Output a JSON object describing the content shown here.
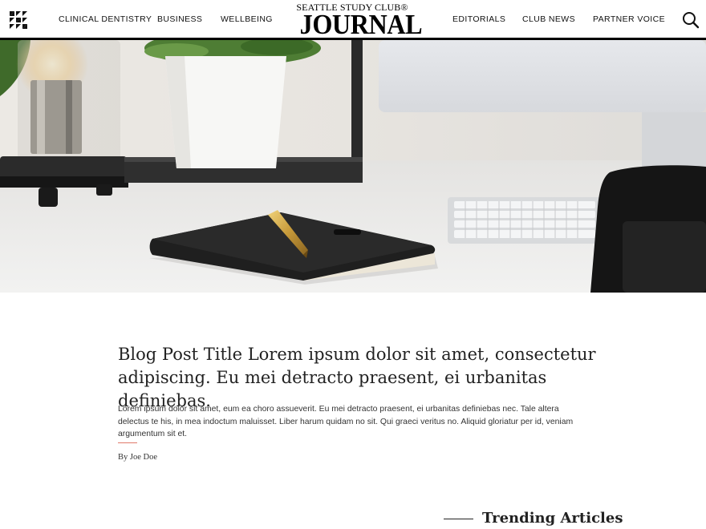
{
  "header": {
    "menu_icon": "hamburger-triangle-grid-icon",
    "nav_left": [
      {
        "label": "CLINICAL DENTISTRY"
      },
      {
        "label": "BUSINESS"
      },
      {
        "label": "WELLBEING"
      }
    ],
    "logo": {
      "top_line": "SEATTLE STUDY CLUB®",
      "main": "JOURNAL"
    },
    "nav_right": [
      {
        "label": "EDITORIALS"
      },
      {
        "label": "CLUB NEWS"
      },
      {
        "label": "PARTNER VOICE"
      }
    ],
    "search_icon": "search-icon"
  },
  "hero": {
    "image": "desk-with-notebook-pen-lamp-plant-monitor-keyboard"
  },
  "article": {
    "title": "Blog Post Title Lorem ipsum dolor sit amet, consectetur adipiscing. Eu mei detracto praesent, ei urbanitas definiebas.",
    "excerpt": "Lorem ipsum dolor sit amet, eum ea choro assueverit. Eu mei detracto praesent, ei urbanitas definiebas nec. Tale altera delectus te his, in mea indoctum maluisset. Liber harum quidam no sit. Qui graeci veritus no. Aliquid gloriatur per id, veniam argumentum sit et.",
    "byline": "By Joe Doe",
    "accent_color": "#e07a6a"
  },
  "trending": {
    "heading": "Trending Articles"
  }
}
